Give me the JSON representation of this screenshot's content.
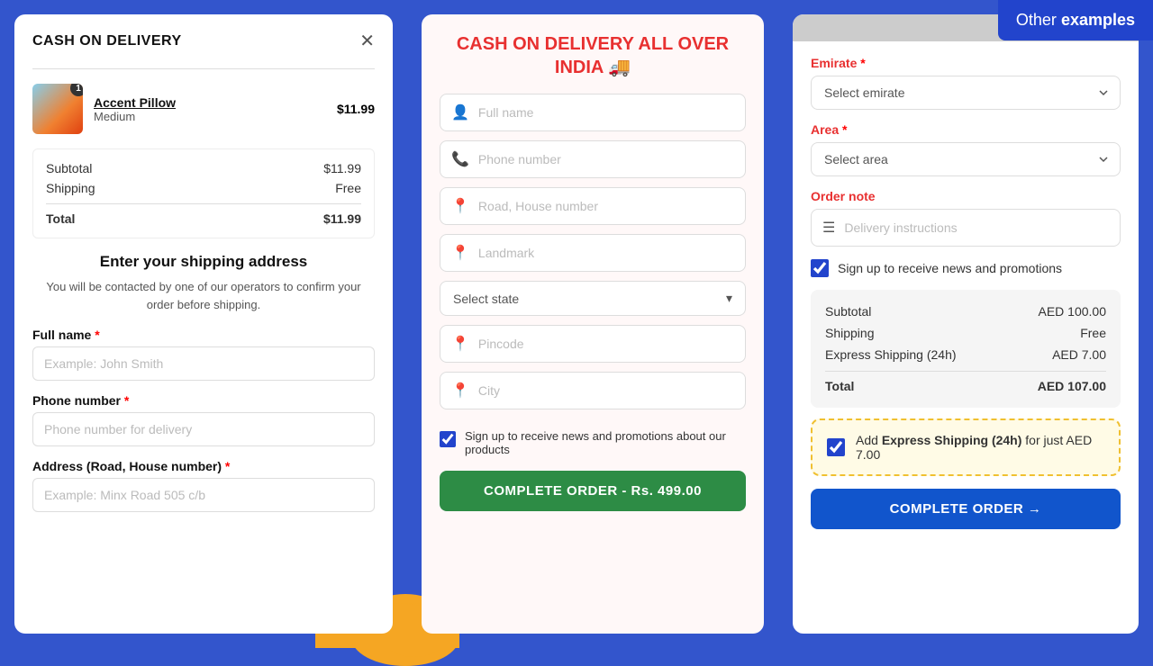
{
  "banner": {
    "text_prefix": "Other ",
    "text_bold": "examples",
    "bg_color": "#2244cc"
  },
  "left_panel": {
    "title": "CASH ON DELIVERY",
    "close_icon": "✕",
    "cart_item": {
      "name": "Accent Pillow",
      "variant": "Medium",
      "price": "$11.99",
      "badge": "1"
    },
    "summary": {
      "subtotal_label": "Subtotal",
      "subtotal_value": "$11.99",
      "shipping_label": "Shipping",
      "shipping_value": "Free",
      "total_label": "Total",
      "total_value": "$11.99"
    },
    "address_section": {
      "heading": "Enter your shipping address",
      "subtext": "You will be contacted by one of our operators to confirm your order before shipping.",
      "full_name_label": "Full name",
      "full_name_placeholder": "Example: John Smith",
      "phone_label": "Phone number",
      "phone_placeholder": "Phone number for delivery",
      "address_label": "Address (Road, House number)",
      "address_placeholder": "Example: Minx Road 505 c/b"
    }
  },
  "middle_panel": {
    "title": "CASH ON DELIVERY ALL OVER INDIA 🚚",
    "fields": [
      {
        "icon": "👤",
        "placeholder": "Full name"
      },
      {
        "icon": "📞",
        "placeholder": "Phone number"
      },
      {
        "icon": "📍",
        "placeholder": "Road, House number"
      },
      {
        "icon": "📍",
        "placeholder": "Landmark"
      }
    ],
    "select_state_label": "Select state",
    "pincode_placeholder": "Pincode",
    "city_placeholder": "City",
    "checkbox_label": "Sign up to receive news and promotions about our products",
    "complete_btn": "COMPLETE ORDER - Rs. 499.00"
  },
  "right_panel": {
    "emirate_label": "Emirate",
    "emirate_required": "*",
    "emirate_placeholder": "Select emirate",
    "area_label": "Area",
    "area_required": "*",
    "area_placeholder": "Select area",
    "order_note_label": "Order note",
    "delivery_placeholder": "Delivery instructions",
    "signup_label": "Sign up to receive news and promotions",
    "summary": {
      "subtotal_label": "Subtotal",
      "subtotal_value": "AED 100.00",
      "shipping_label": "Shipping",
      "shipping_value": "Free",
      "express_label": "Express Shipping (24h)",
      "express_value": "AED 7.00",
      "total_label": "Total",
      "total_value": "AED 107.00"
    },
    "express_banner": {
      "text_prefix": "Add ",
      "text_bold": "Express Shipping (24h)",
      "text_suffix": " for just AED 7.00"
    },
    "complete_btn": "COMPLETE ORDER →"
  }
}
